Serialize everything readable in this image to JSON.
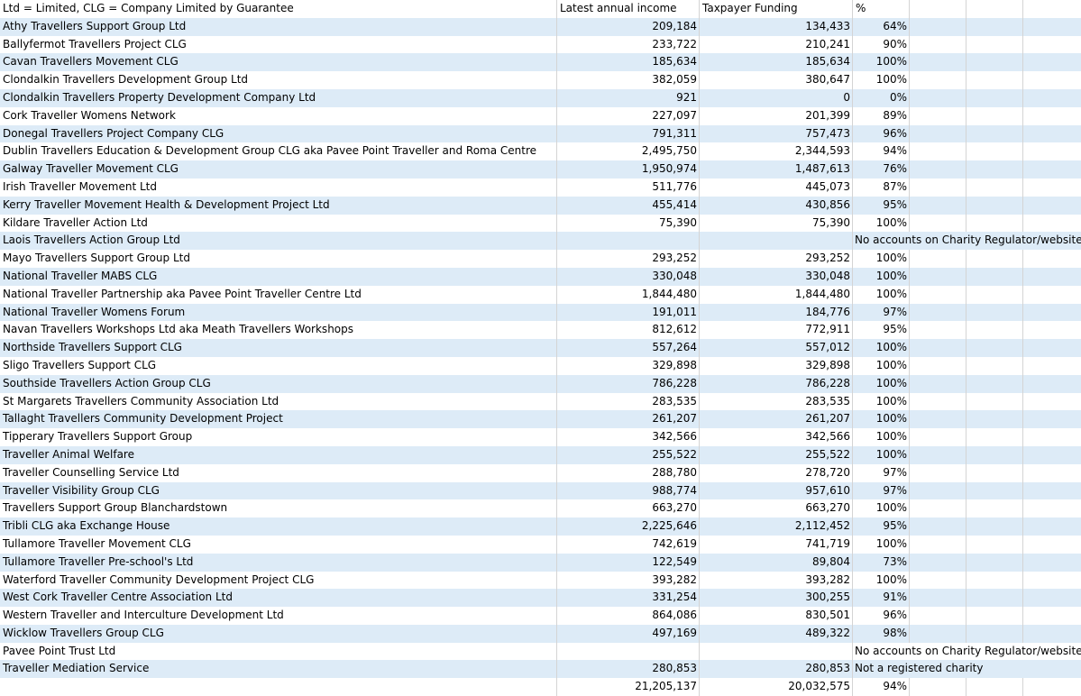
{
  "header": {
    "name": "Ltd = Limited, CLG = Company Limited by Guarantee",
    "income": "Latest annual income",
    "tax": "Taxpayer Funding",
    "pct": "%"
  },
  "rows": [
    {
      "name": "Athy Travellers Support Group Ltd",
      "income": "209,184",
      "tax": "134,433",
      "pct": "64%",
      "note": ""
    },
    {
      "name": "Ballyfermot Travellers Project CLG",
      "income": "233,722",
      "tax": "210,241",
      "pct": "90%",
      "note": ""
    },
    {
      "name": "Cavan Travellers Movement CLG",
      "income": "185,634",
      "tax": "185,634",
      "pct": "100%",
      "note": ""
    },
    {
      "name": "Clondalkin Travellers Development Group Ltd",
      "income": "382,059",
      "tax": "380,647",
      "pct": "100%",
      "note": ""
    },
    {
      "name": "Clondalkin Travellers Property Development Company Ltd",
      "income": "921",
      "tax": "0",
      "pct": "0%",
      "note": ""
    },
    {
      "name": "Cork Traveller Womens Network",
      "income": "227,097",
      "tax": "201,399",
      "pct": "89%",
      "note": ""
    },
    {
      "name": "Donegal Travellers Project Company CLG",
      "income": "791,311",
      "tax": "757,473",
      "pct": "96%",
      "note": ""
    },
    {
      "name": "Dublin Travellers Education & Development Group CLG aka Pavee Point Traveller and Roma Centre",
      "income": "2,495,750",
      "tax": "2,344,593",
      "pct": "94%",
      "note": ""
    },
    {
      "name": "Galway Traveller Movement CLG",
      "income": "1,950,974",
      "tax": "1,487,613",
      "pct": "76%",
      "note": ""
    },
    {
      "name": "Irish Traveller Movement Ltd",
      "income": "511,776",
      "tax": "445,073",
      "pct": "87%",
      "note": ""
    },
    {
      "name": "Kerry Traveller Movement Health & Development Project Ltd",
      "income": "455,414",
      "tax": "430,856",
      "pct": "95%",
      "note": ""
    },
    {
      "name": "Kildare Traveller Action Ltd",
      "income": "75,390",
      "tax": "75,390",
      "pct": "100%",
      "note": ""
    },
    {
      "name": "Laois Travellers Action Group Ltd",
      "income": "",
      "tax": "",
      "pct": "",
      "note": "No accounts on Charity Regulator/website"
    },
    {
      "name": "Mayo Travellers Support Group Ltd",
      "income": "293,252",
      "tax": "293,252",
      "pct": "100%",
      "note": ""
    },
    {
      "name": "National Traveller MABS CLG",
      "income": "330,048",
      "tax": "330,048",
      "pct": "100%",
      "note": ""
    },
    {
      "name": "National Traveller Partnership aka Pavee Point Traveller Centre Ltd",
      "income": "1,844,480",
      "tax": "1,844,480",
      "pct": "100%",
      "note": ""
    },
    {
      "name": "National Traveller Womens Forum",
      "income": "191,011",
      "tax": "184,776",
      "pct": "97%",
      "note": ""
    },
    {
      "name": "Navan Travellers Workshops Ltd aka Meath Travellers Workshops",
      "income": "812,612",
      "tax": "772,911",
      "pct": "95%",
      "note": ""
    },
    {
      "name": "Northside Travellers Support CLG",
      "income": "557,264",
      "tax": "557,012",
      "pct": "100%",
      "note": ""
    },
    {
      "name": "Sligo Travellers Support CLG",
      "income": "329,898",
      "tax": "329,898",
      "pct": "100%",
      "note": ""
    },
    {
      "name": "Southside Travellers Action Group CLG",
      "income": "786,228",
      "tax": "786,228",
      "pct": "100%",
      "note": ""
    },
    {
      "name": "St Margarets Travellers Community Association Ltd",
      "income": "283,535",
      "tax": "283,535",
      "pct": "100%",
      "note": ""
    },
    {
      "name": "Tallaght Travellers Community Development Project",
      "income": "261,207",
      "tax": "261,207",
      "pct": "100%",
      "note": ""
    },
    {
      "name": "Tipperary Travellers Support Group",
      "income": "342,566",
      "tax": "342,566",
      "pct": "100%",
      "note": ""
    },
    {
      "name": "Traveller Animal Welfare",
      "income": "255,522",
      "tax": "255,522",
      "pct": "100%",
      "note": ""
    },
    {
      "name": "Traveller Counselling Service Ltd",
      "income": "288,780",
      "tax": "278,720",
      "pct": "97%",
      "note": ""
    },
    {
      "name": "Traveller Visibility Group CLG",
      "income": "988,774",
      "tax": "957,610",
      "pct": "97%",
      "note": ""
    },
    {
      "name": "Travellers Support Group Blanchardstown",
      "income": "663,270",
      "tax": "663,270",
      "pct": "100%",
      "note": ""
    },
    {
      "name": "Tribli CLG aka Exchange House",
      "income": "2,225,646",
      "tax": "2,112,452",
      "pct": "95%",
      "note": ""
    },
    {
      "name": "Tullamore Traveller Movement CLG",
      "income": "742,619",
      "tax": "741,719",
      "pct": "100%",
      "note": ""
    },
    {
      "name": "Tullamore Traveller Pre-school's Ltd",
      "income": "122,549",
      "tax": "89,804",
      "pct": "73%",
      "note": ""
    },
    {
      "name": "Waterford Traveller Community Development Project CLG",
      "income": "393,282",
      "tax": "393,282",
      "pct": "100%",
      "note": ""
    },
    {
      "name": "West Cork Traveller Centre Association Ltd",
      "income": "331,254",
      "tax": "300,255",
      "pct": "91%",
      "note": ""
    },
    {
      "name": "Western Traveller and Interculture Development Ltd",
      "income": "864,086",
      "tax": "830,501",
      "pct": "96%",
      "note": ""
    },
    {
      "name": "Wicklow Travellers Group CLG",
      "income": "497,169",
      "tax": "489,322",
      "pct": "98%",
      "note": ""
    },
    {
      "name": "Pavee Point Trust Ltd",
      "income": "",
      "tax": "",
      "pct": "",
      "note": "No accounts on Charity Regulator/website"
    },
    {
      "name": "Traveller Mediation Service",
      "income": "280,853",
      "tax": "280,853",
      "pct": "",
      "note": "Not a registered charity"
    }
  ],
  "totals": {
    "name": "",
    "income": "21,205,137",
    "tax": "20,032,575",
    "pct": "94%"
  },
  "colors": {
    "band": "#ddebf7",
    "gridline": "#d4d4d4"
  }
}
